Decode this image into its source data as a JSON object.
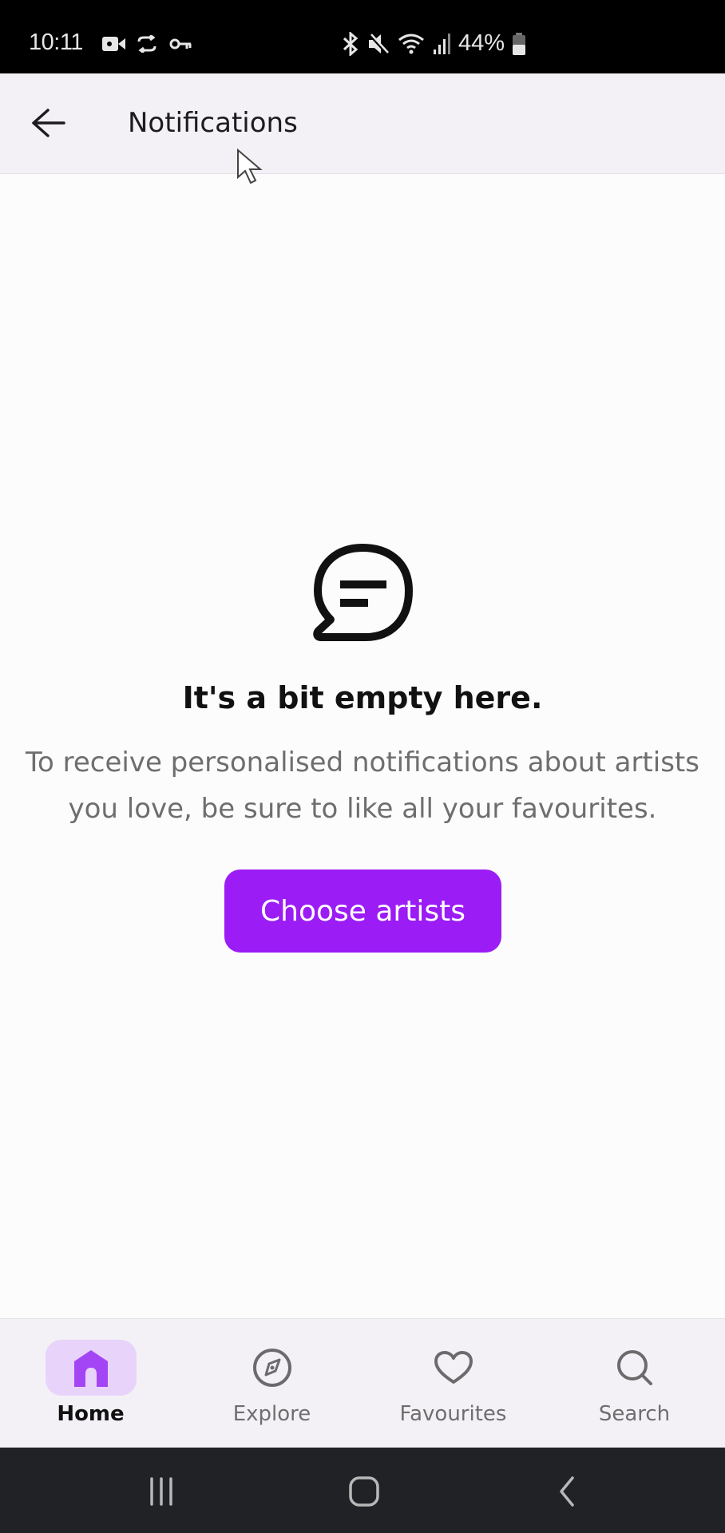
{
  "status_bar": {
    "time": "10:11",
    "left_icons": [
      "video-camera-icon",
      "sync-check-icon",
      "vpn-key-icon"
    ],
    "right_icons": [
      "bluetooth-icon",
      "mute-icon",
      "wifi-icon",
      "signal-icon"
    ],
    "battery_percent": "44%"
  },
  "header": {
    "back_icon": "arrow-left-icon",
    "title": "Notifications"
  },
  "empty_state": {
    "icon": "chat-bubble-icon",
    "title": "It's a bit empty here.",
    "description": "To receive personalised notifications about artists you love, be sure to like all your favourites.",
    "button_label": "Choose artists"
  },
  "bottom_nav": {
    "items": [
      {
        "label": "Home",
        "icon": "home-icon",
        "active": true
      },
      {
        "label": "Explore",
        "icon": "compass-icon",
        "active": false
      },
      {
        "label": "Favourites",
        "icon": "heart-icon",
        "active": false
      },
      {
        "label": "Search",
        "icon": "search-icon",
        "active": false
      }
    ]
  },
  "system_nav": {
    "buttons": [
      "recents-icon",
      "home-circle-icon",
      "back-chevron-icon"
    ]
  },
  "colors": {
    "accent": "#9b1cf5",
    "active_pill": "#e8d3fb",
    "header_bg": "#f3f1f6",
    "system_nav_bg": "#202226"
  }
}
